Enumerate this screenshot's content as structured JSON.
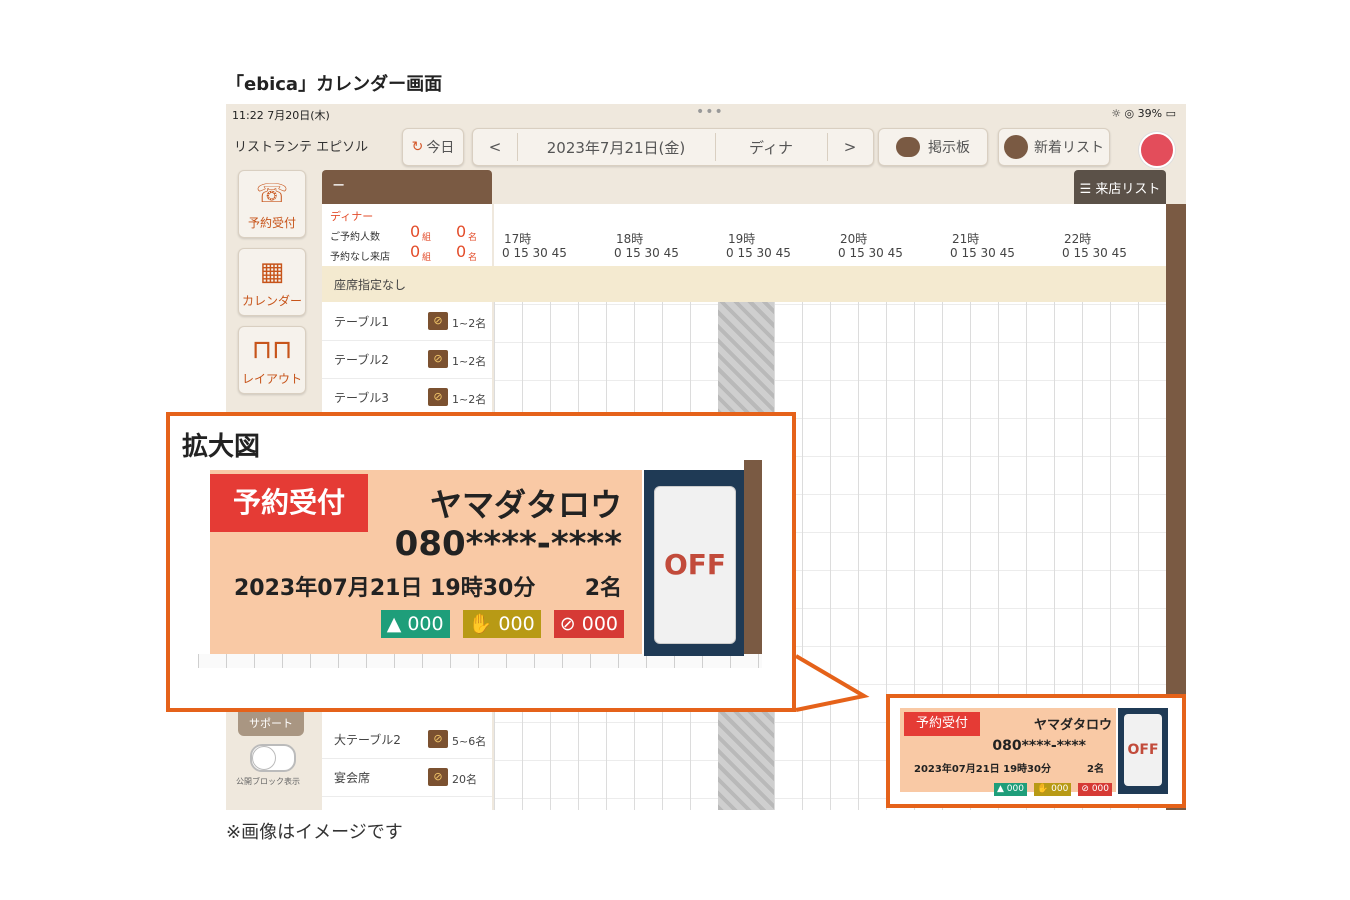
{
  "caption_top": "「ebica」カレンダー画面",
  "caption_bottom": "※画像はイメージです",
  "status": {
    "time": "11:22  7月20日(木)",
    "dots": "•••",
    "right": "☼ ◎ 39% ▭"
  },
  "header": {
    "restaurant": "リストランテ エピソル",
    "today_label": "今日",
    "prev": "<",
    "date": "2023年7月21日(金)",
    "meal": "ディナ",
    "next": ">",
    "bulletin": "掲示板",
    "new_list": "新着リスト"
  },
  "nav": [
    {
      "icon": "☏",
      "label": "予約受付"
    },
    {
      "icon": "▦",
      "label": "カレンダー"
    },
    {
      "icon": "⊓⊓",
      "label": "レイアウト"
    }
  ],
  "support_label": "サポート",
  "toggle_label": "公開ブロック表示",
  "panel": {
    "collapse": "−",
    "visit_list": "☰ 来店リスト",
    "meal_title": "ディナー",
    "row1": "ご予約人数",
    "row2": "予約なし来店",
    "zero": "0",
    "group_unit": "組",
    "person_unit": "名",
    "seatless": "座席指定なし"
  },
  "hours": [
    "17時",
    "18時",
    "19時",
    "20時",
    "21時",
    "22時"
  ],
  "minutes": "0  15  30  45",
  "seats": [
    {
      "name": "テーブル1",
      "cap": "1~2名"
    },
    {
      "name": "テーブル2",
      "cap": "1~2名"
    },
    {
      "name": "テーブル3",
      "cap": "1~2名"
    }
  ],
  "seats_lower": [
    {
      "name": "大テーブル2",
      "cap": "5~6名"
    },
    {
      "name": "宴会席",
      "cap": "20名"
    }
  ],
  "notification": {
    "tag": "予約受付",
    "name": "ヤマダタロウ",
    "phone": "080****-****",
    "datetime": "2023年07月21日 19時30分",
    "count": "2名",
    "chip1": "000",
    "chip2": "000",
    "chip3": "000",
    "off": "OFF"
  },
  "zoom_title": "拡大図",
  "colors": {
    "accent_orange": "#e5621a",
    "tag_red": "#e53b35",
    "card_peach": "#f9c9a5",
    "chip_green": "#1e9e7a",
    "chip_olive": "#b89a15",
    "chip_red": "#d63a35",
    "navy": "#1f3a55",
    "brown": "#7a5a43"
  }
}
